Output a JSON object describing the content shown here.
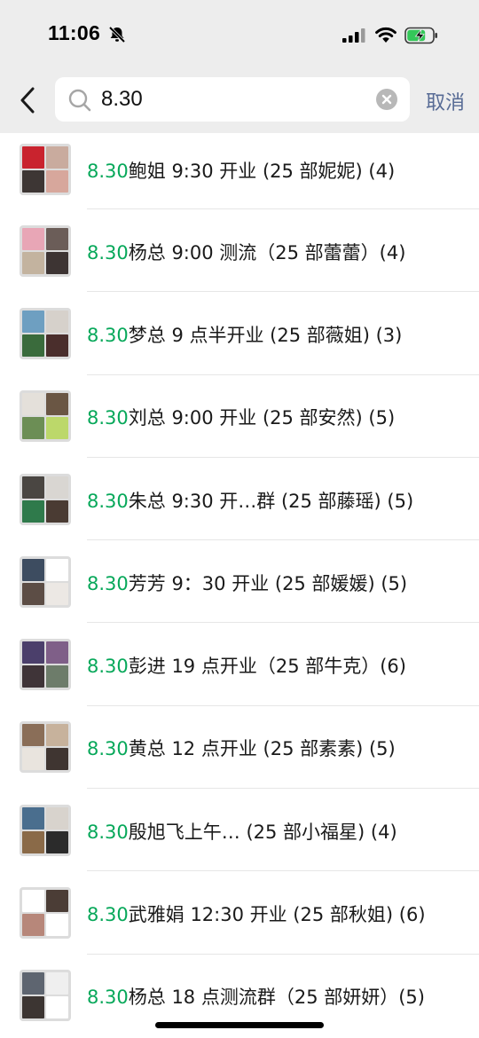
{
  "status_bar": {
    "time": "11:06",
    "icons": [
      "bell-mute-icon",
      "signal-icon",
      "wifi-icon",
      "battery-charging-icon"
    ]
  },
  "search": {
    "query": "8.30",
    "cancel_label": "取消",
    "icons": [
      "back-chevron-icon",
      "search-icon",
      "clear-icon"
    ]
  },
  "results": [
    {
      "highlight": "8.30",
      "rest": "鲍姐 9:30 开业 (25 部妮妮) (4)"
    },
    {
      "highlight": "8.30",
      "rest": "杨总 9:00 测流（25 部蕾蕾）(4)"
    },
    {
      "highlight": "8.30",
      "rest": "梦总 9 点半开业 (25 部薇姐) (3)"
    },
    {
      "highlight": "8.30",
      "rest": "刘总 9:00 开业 (25 部安然) (5)"
    },
    {
      "highlight": "8.30",
      "rest": "朱总 9:30 开…群 (25 部藤瑶) (5)"
    },
    {
      "highlight": "8.30",
      "rest": "芳芳 9：30 开业 (25 部媛媛) (5)"
    },
    {
      "highlight": "8.30",
      "rest": "彭进 19 点开业（25 部牛克）(6)"
    },
    {
      "highlight": "8.30",
      "rest": "黄总 12 点开业 (25 部素素) (5)"
    },
    {
      "highlight": "8.30",
      "rest": "殷旭飞上午… (25 部小福星) (4)"
    },
    {
      "highlight": "8.30",
      "rest": "武雅娟 12:30 开业 (25 部秋姐) (6)"
    },
    {
      "highlight": "8.30",
      "rest": "杨总 18 点测流群（25 部妍妍）(5)"
    }
  ],
  "colors": {
    "header_bg": "#ededed",
    "highlight": "#07a85a",
    "cancel": "#576b95",
    "avatar_bg": "#dcdcdc"
  }
}
